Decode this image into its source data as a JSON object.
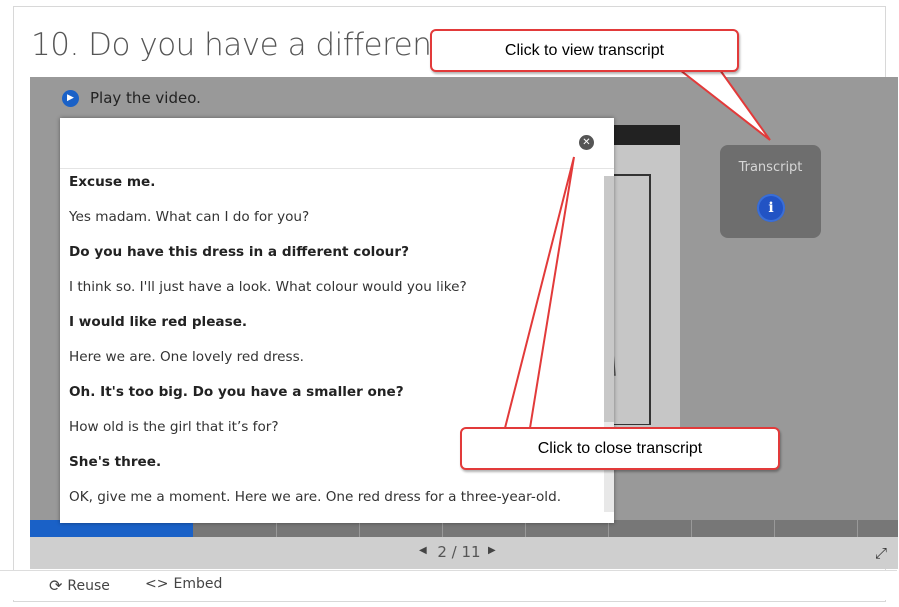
{
  "question": {
    "title": "10. Do you have a different colour?"
  },
  "content": {
    "play_label": "Play the video.",
    "transcript_button_label": "Transcript",
    "progress": {
      "current": "2 / 11"
    }
  },
  "transcript": {
    "lines": [
      {
        "text": "Excuse me.",
        "bold": true
      },
      {
        "text": "Yes madam. What can I do for you?",
        "bold": false
      },
      {
        "text": "Do you have this dress in a different colour?",
        "bold": true
      },
      {
        "text": "I think so. I'll just have a look. What colour would you like?",
        "bold": false
      },
      {
        "text": "I would like red please.",
        "bold": true
      },
      {
        "text": "Here we are. One lovely red dress.",
        "bold": false
      },
      {
        "text": "Oh. It's too big. Do you have a smaller one?",
        "bold": true
      },
      {
        "text": "How old is the girl that it’s for?",
        "bold": false
      },
      {
        "text": "She's three.",
        "bold": true
      },
      {
        "text": "OK, give me a moment. Here we are. One red dress for a three-year-old.",
        "bold": false
      }
    ]
  },
  "callouts": {
    "view_transcript": "Click to view transcript",
    "close_transcript": "Click to close transcript"
  },
  "footer": {
    "reuse_label": "Reuse",
    "embed_label": "Embed"
  },
  "icons": {
    "play": "speaker-icon",
    "info": "info-icon",
    "close": "close-icon",
    "prev": "triangle-left-icon",
    "next": "triangle-right-icon",
    "fullscreen": "expand-icon",
    "reuse": "refresh-icon",
    "embed": "code-icon"
  },
  "colors": {
    "accent": "#1a61c7",
    "callout_border": "#e23a3a"
  }
}
